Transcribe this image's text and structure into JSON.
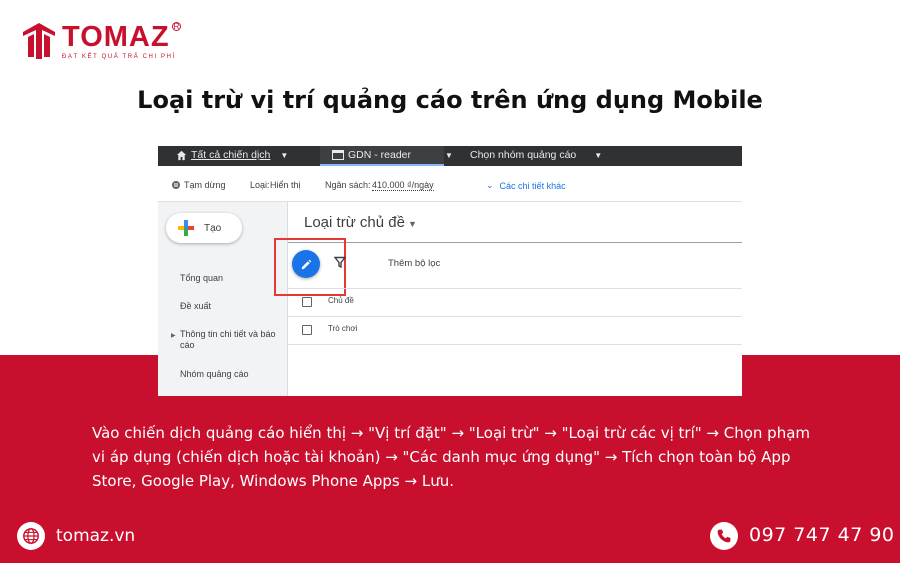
{
  "brand": {
    "name": "TOMAZ",
    "registered": "R",
    "tagline": "ĐẠT KẾT QUẢ TRẢ CHI PHÍ",
    "color": "#c8102e"
  },
  "page": {
    "title": "Loại trừ vị trí quảng cáo trên ứng dụng Mobile"
  },
  "screenshot": {
    "topbar": {
      "campaigns_link": "Tất cả chiến dịch",
      "campaign": "GDN - reader",
      "ad_group": "Chọn nhóm quảng cáo"
    },
    "status_bar": {
      "status": "Tạm dừng",
      "type_label": "Loại:",
      "type_value": "Hiển thị",
      "budget_label": "Ngân sách:",
      "budget_value": "410.000 ₫/ngày",
      "more_details": "Các chi tiết khác"
    },
    "sidebar": {
      "create_label": "Tạo",
      "items": [
        {
          "label": "Tổng quan"
        },
        {
          "label": "Đề xuất"
        },
        {
          "label": "Thông tin chi tiết và báo"
        },
        {
          "label": "cáo"
        },
        {
          "label": "Nhóm quảng cáo"
        }
      ]
    },
    "main": {
      "title": "Loại trừ chủ đề",
      "add_filter": "Thêm bộ lọc",
      "rows": [
        {
          "label": "Chủ đề"
        },
        {
          "label": "Trò chơi"
        }
      ]
    }
  },
  "description": "Vào chiến dịch quảng cáo hiển thị → \"Vị trí đặt\" → \"Loại trừ\" → \"Loại trừ các vị trí\" → Chọn phạm vi áp dụng (chiến dịch hoặc tài khoản) → \"Các danh mục ứng dụng\" → Tích chọn toàn bộ App Store, Google Play, Windows Phone Apps → Lưu.",
  "footer": {
    "website": "tomaz.vn",
    "phone": "097 747 47 90",
    "website_icon": "globe-icon",
    "phone_icon": "phone-icon"
  }
}
